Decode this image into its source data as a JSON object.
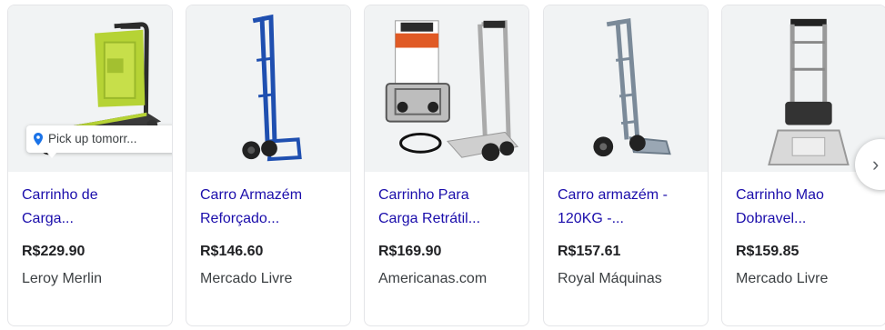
{
  "pickup_badge": "Pick up tomorr...",
  "next_icon_glyph": "›",
  "products": [
    {
      "title_line1": "Carrinho de",
      "title_line2": "Carga...",
      "price": "R$229.90",
      "seller": "Leroy Merlin"
    },
    {
      "title_line1": "Carro Armazém",
      "title_line2": "Reforçado...",
      "price": "R$146.60",
      "seller": "Mercado Livre"
    },
    {
      "title_line1": "Carrinho Para",
      "title_line2": "Carga Retrátil...",
      "price": "R$169.90",
      "seller": "Americanas.com"
    },
    {
      "title_line1": "Carro armazém -",
      "title_line2": "120KG -...",
      "price": "R$157.61",
      "seller": "Royal Máquinas"
    },
    {
      "title_line1": "Carrinho Mao",
      "title_line2": "Dobravel...",
      "price": "R$159.85",
      "seller": "Mercado Livre"
    }
  ],
  "colors": {
    "link": "#1a0dab",
    "price": "#202124",
    "seller": "#3c4043",
    "pin": "#1a73e8",
    "thumb_bg": "#f1f3f4"
  }
}
